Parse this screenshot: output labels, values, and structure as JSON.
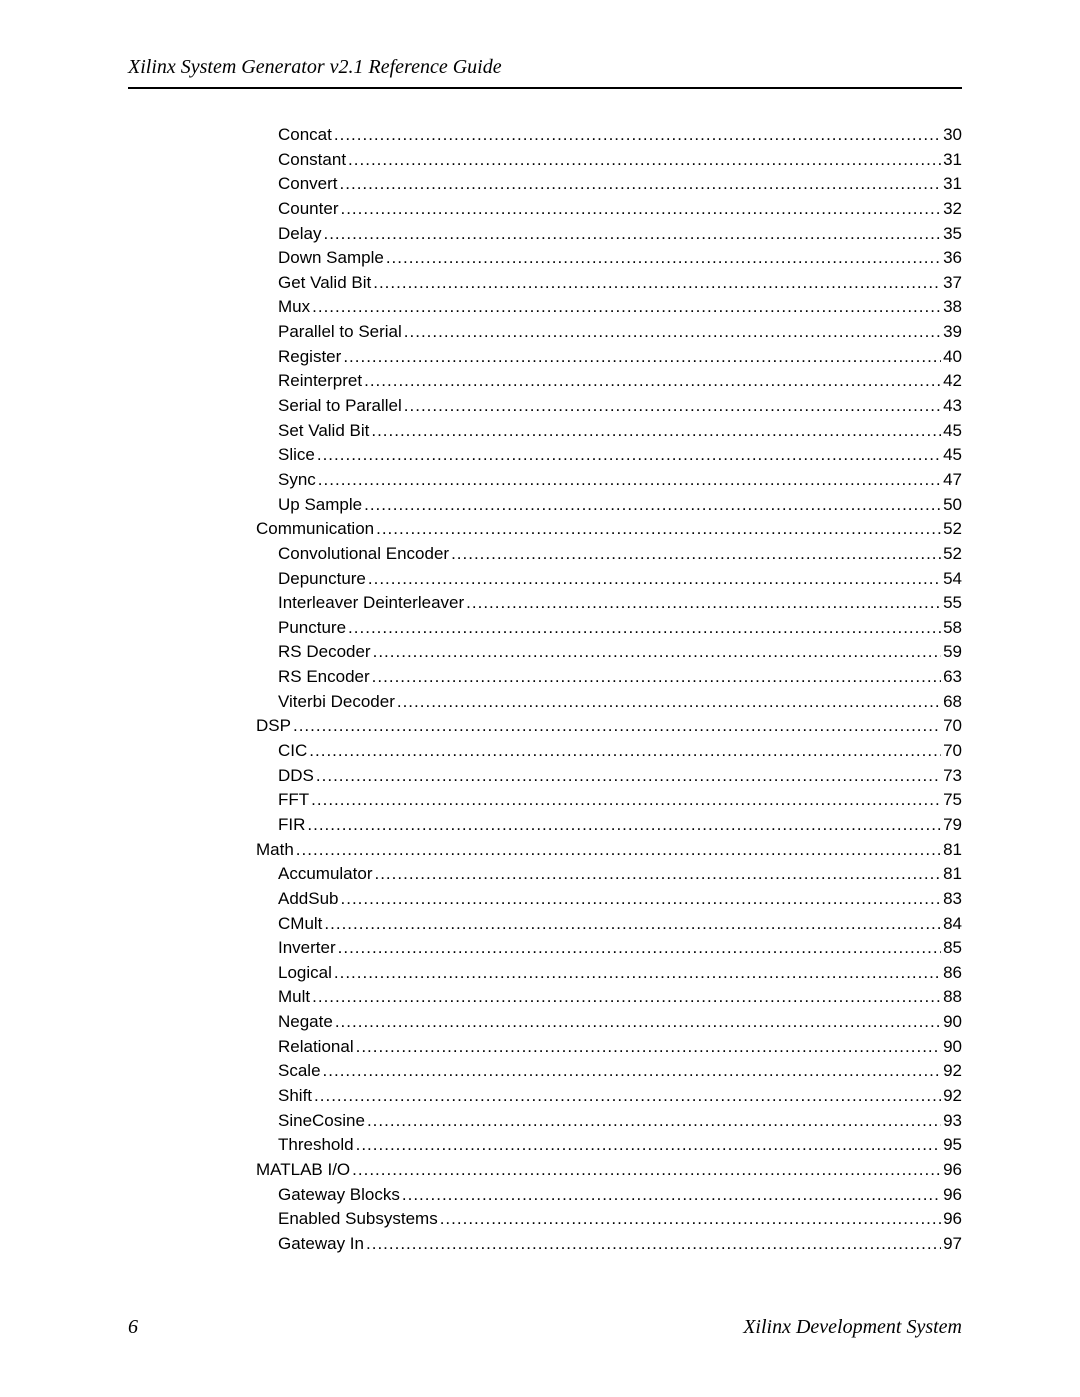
{
  "header": {
    "title": "Xilinx System Generator v2.1 Reference Guide"
  },
  "toc": [
    {
      "label": "Concat",
      "page": "30",
      "indent": 2
    },
    {
      "label": "Constant",
      "page": "31",
      "indent": 2
    },
    {
      "label": "Convert",
      "page": "31",
      "indent": 2
    },
    {
      "label": "Counter",
      "page": "32",
      "indent": 2
    },
    {
      "label": "Delay",
      "page": "35",
      "indent": 2
    },
    {
      "label": "Down Sample",
      "page": "36",
      "indent": 2
    },
    {
      "label": "Get Valid Bit",
      "page": "37",
      "indent": 2
    },
    {
      "label": "Mux",
      "page": "38",
      "indent": 2
    },
    {
      "label": "Parallel to Serial",
      "page": "39",
      "indent": 2
    },
    {
      "label": "Register",
      "page": "40",
      "indent": 2
    },
    {
      "label": "Reinterpret",
      "page": "42",
      "indent": 2
    },
    {
      "label": "Serial to Parallel",
      "page": "43",
      "indent": 2
    },
    {
      "label": "Set Valid Bit",
      "page": "45",
      "indent": 2
    },
    {
      "label": "Slice",
      "page": "45",
      "indent": 2
    },
    {
      "label": "Sync",
      "page": "47",
      "indent": 2
    },
    {
      "label": "Up Sample",
      "page": "50",
      "indent": 2
    },
    {
      "label": "Communication",
      "page": "52",
      "indent": 1
    },
    {
      "label": "Convolutional Encoder",
      "page": "52",
      "indent": 2
    },
    {
      "label": "Depuncture",
      "page": "54",
      "indent": 2
    },
    {
      "label": "Interleaver Deinterleaver",
      "page": "55",
      "indent": 2
    },
    {
      "label": "Puncture",
      "page": "58",
      "indent": 2
    },
    {
      "label": "RS Decoder",
      "page": "59",
      "indent": 2
    },
    {
      "label": "RS Encoder",
      "page": "63",
      "indent": 2
    },
    {
      "label": "Viterbi Decoder",
      "page": "68",
      "indent": 2
    },
    {
      "label": "DSP",
      "page": "70",
      "indent": 1
    },
    {
      "label": "CIC",
      "page": "70",
      "indent": 2
    },
    {
      "label": "DDS",
      "page": "73",
      "indent": 2
    },
    {
      "label": "FFT",
      "page": "75",
      "indent": 2
    },
    {
      "label": "FIR",
      "page": "79",
      "indent": 2
    },
    {
      "label": "Math",
      "page": "81",
      "indent": 1
    },
    {
      "label": "Accumulator",
      "page": "81",
      "indent": 2
    },
    {
      "label": "AddSub",
      "page": "83",
      "indent": 2
    },
    {
      "label": "CMult",
      "page": "84",
      "indent": 2
    },
    {
      "label": "Inverter",
      "page": "85",
      "indent": 2
    },
    {
      "label": "Logical",
      "page": "86",
      "indent": 2
    },
    {
      "label": "Mult",
      "page": "88",
      "indent": 2
    },
    {
      "label": "Negate",
      "page": "90",
      "indent": 2
    },
    {
      "label": "Relational",
      "page": "90",
      "indent": 2
    },
    {
      "label": "Scale",
      "page": "92",
      "indent": 2
    },
    {
      "label": "Shift",
      "page": "92",
      "indent": 2
    },
    {
      "label": "SineCosine",
      "page": "93",
      "indent": 2
    },
    {
      "label": "Threshold",
      "page": "95",
      "indent": 2
    },
    {
      "label": "MATLAB I/O",
      "page": "96",
      "indent": 1
    },
    {
      "label": "Gateway Blocks",
      "page": "96",
      "indent": 2
    },
    {
      "label": "Enabled Subsystems",
      "page": "96",
      "indent": 2
    },
    {
      "label": "Gateway In",
      "page": "97",
      "indent": 2
    }
  ],
  "footer": {
    "page_number": "6",
    "right_text": "Xilinx Development System"
  }
}
